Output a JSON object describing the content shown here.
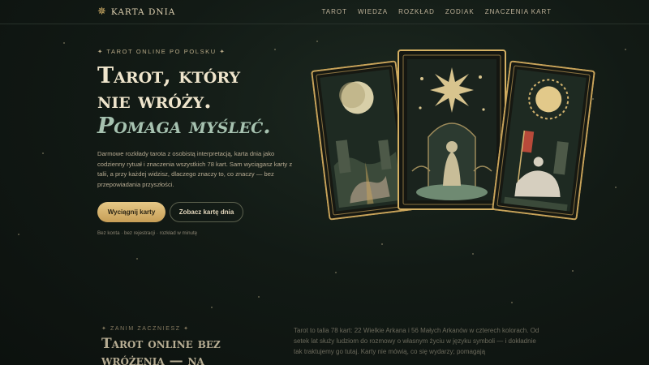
{
  "nav": {
    "logo_icon": "star-icon",
    "logo_text": "KARTA DNIA",
    "items": [
      {
        "label": "TAROT"
      },
      {
        "label": "WIEDZA"
      },
      {
        "label": "ROZKŁAD"
      },
      {
        "label": "ZODIAK"
      },
      {
        "label": "ZNACZENIA KART"
      }
    ]
  },
  "hero": {
    "eyebrow": "✦ TAROT ONLINE PO POLSKU ✦",
    "title_line1": "Tarot, który",
    "title_line2": "nie wróży.",
    "title_line3": "Pomaga myśleć.",
    "description": "Darmowe rozkłady tarota z osobistą interpretacją, karta dnia jako codzienny rytuał i znaczenia wszystkich 78 kart. Sam wyciągasz karty z talii, a przy każdej widzisz, dlaczego znaczy to, co znaczy — bez przepowiadania przyszłości.",
    "primary_button": "Wyciągnij karty",
    "secondary_button": "Zobacz kartę dnia",
    "note": "Bez konta · bez rejestracji · rozkład w minutę"
  },
  "cards": [
    {
      "name": "moon-card",
      "icon": "moon-icon"
    },
    {
      "name": "star-card",
      "icon": "star-icon"
    },
    {
      "name": "sun-card",
      "icon": "sun-icon"
    }
  ],
  "section": {
    "eyebrow": "✦ ZANIM ZACZNIESZ ✦",
    "title": "Tarot online bez wróżenia — na",
    "text": "Tarot to talia 78 kart: 22 Wielkie Arkana i 56 Małych Arkanów w czterech kolorach. Od setek lat służy ludziom do rozmowy o własnym życiu w języku symboli — i dokładnie tak traktujemy go tutaj. Karty nie mówią, co się wydarzy; pomagają"
  },
  "colors": {
    "background": "#121a15",
    "gold": "#d3b168",
    "cream": "#efe5cc",
    "sage": "#a6c2b0"
  }
}
